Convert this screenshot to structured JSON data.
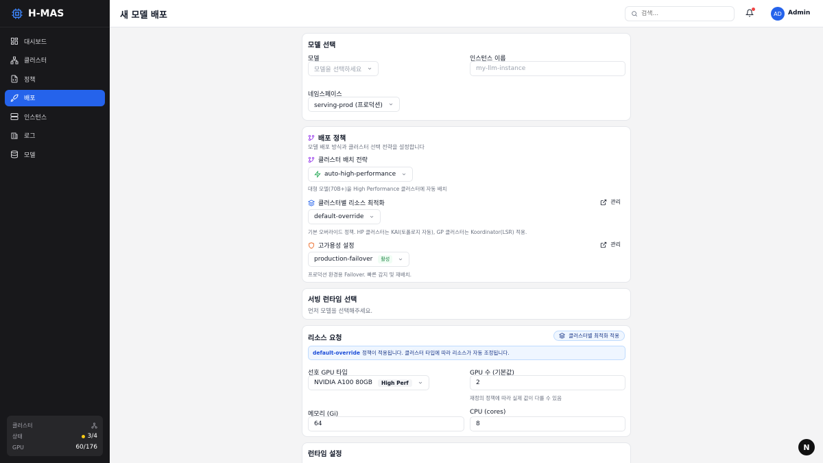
{
  "app": {
    "name": "H-MAS"
  },
  "sidebar": {
    "items": [
      {
        "label": "대시보드",
        "icon": "dashboard-icon",
        "active": false
      },
      {
        "label": "클러스터",
        "icon": "network-icon",
        "active": false
      },
      {
        "label": "정책",
        "icon": "policy-file-icon",
        "active": false
      },
      {
        "label": "배포",
        "icon": "rocket-icon",
        "active": true
      },
      {
        "label": "인스턴스",
        "icon": "server-icon",
        "active": false
      },
      {
        "label": "로그",
        "icon": "log-icon",
        "active": false
      },
      {
        "label": "모델",
        "icon": "database-icon",
        "active": false
      }
    ],
    "cluster_card": {
      "title": "클러스터",
      "status_label": "상태",
      "status_value": "3/4",
      "gpu_label": "GPU",
      "gpu_value": "60/176"
    }
  },
  "header": {
    "title": "새 모델 배포",
    "search_placeholder": "검색...",
    "avatar_initials": "AD",
    "user_name": "Admin"
  },
  "model_select": {
    "title": "모델 선택",
    "model_label": "모델",
    "model_placeholder": "모델을 선택하세요",
    "instance_label": "인스턴스 이름",
    "instance_placeholder": "my-llm-instance",
    "namespace_label": "네임스페이스",
    "namespace_value": "serving-prod (프로덕션)"
  },
  "deploy_policy": {
    "title": "배포 정책",
    "subtitle": "모델 배포 방식과 클러스터 선택 전략을 설정합니다",
    "placement_label": "클러스터 배치 전략",
    "placement_value": "auto-high-performance",
    "placement_help": "대형 모델(70B+)을 High Performance 클러스터에 자동 배치",
    "resource_label": "클러스터별 리소스 최적화",
    "resource_value": "default-override",
    "resource_help": "기본 오버라이드 정책. HP 클러스터는 KAI(토폴로지 자동), GP 클러스터는 Koordinator(LSR) 적용.",
    "ha_label": "고가용성 설정",
    "ha_value": "production-failover",
    "ha_badge": "활성",
    "ha_help": "프로덕션 환경용 Failover. 빠른 감지 및 재배치.",
    "manage_label": "관리"
  },
  "serving_runtime": {
    "title": "서빙 런타임 선택",
    "message": "먼저 모델을 선택해주세요."
  },
  "resource_request": {
    "title": "리소스 요청",
    "apply_button": "클러스터별 최적화 적용",
    "info_policy": "default-override",
    "info_text": "정책이 적용됩니다. 클러스터 타입에 따라 리소스가 자동 조정됩니다.",
    "gpu_type_label": "선호 GPU 타입",
    "gpu_type_value": "NVIDIA A100 80GB",
    "gpu_type_badge": "High Perf",
    "gpu_count_label": "GPU 수 (기본값)",
    "gpu_count_value": "2",
    "gpu_count_help": "재정의 정책에 따라 실제 값이 다를 수 있음",
    "memory_label": "메모리 (Gi)",
    "memory_value": "64",
    "cpu_label": "CPU (cores)",
    "cpu_value": "8"
  },
  "runtime_settings": {
    "title": "런타임 설정"
  },
  "fab": {
    "label": "N"
  },
  "colors": {
    "primary": "#2563eb",
    "sidebar_bg": "#18181b",
    "purple_accent": "#9333ea",
    "green_accent": "#16a34a",
    "orange_accent": "#ea580c"
  }
}
